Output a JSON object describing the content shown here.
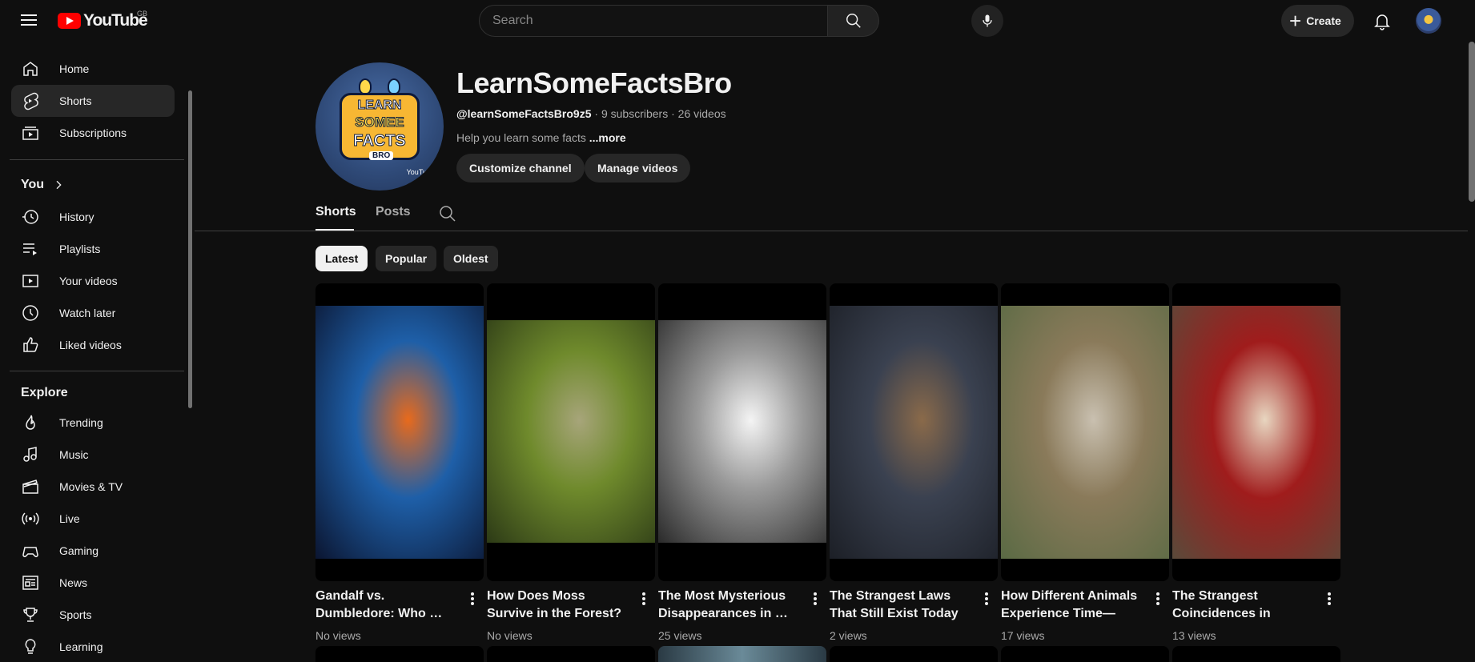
{
  "topbar": {
    "logo_text": "YouTube",
    "country_code": "GB",
    "search_placeholder": "Search",
    "create_label": "Create"
  },
  "sidebar": {
    "primary": [
      {
        "label": "Home",
        "icon": "home-icon"
      },
      {
        "label": "Shorts",
        "icon": "shorts-icon",
        "active": true
      },
      {
        "label": "Subscriptions",
        "icon": "subscriptions-icon"
      }
    ],
    "you_heading": "You",
    "you_items": [
      {
        "label": "History",
        "icon": "history-icon"
      },
      {
        "label": "Playlists",
        "icon": "playlists-icon"
      },
      {
        "label": "Your videos",
        "icon": "your-videos-icon"
      },
      {
        "label": "Watch later",
        "icon": "watch-later-icon"
      },
      {
        "label": "Liked videos",
        "icon": "liked-videos-icon"
      }
    ],
    "explore_heading": "Explore",
    "explore_items": [
      {
        "label": "Trending",
        "icon": "trending-icon"
      },
      {
        "label": "Music",
        "icon": "music-icon"
      },
      {
        "label": "Movies & TV",
        "icon": "movies-icon"
      },
      {
        "label": "Live",
        "icon": "live-icon"
      },
      {
        "label": "Gaming",
        "icon": "gaming-icon"
      },
      {
        "label": "News",
        "icon": "news-icon"
      },
      {
        "label": "Sports",
        "icon": "sports-icon"
      },
      {
        "label": "Learning",
        "icon": "learning-icon"
      }
    ]
  },
  "channel": {
    "name": "LearnSomeFactsBro",
    "handle": "@learnSomeFactsBro9z5",
    "subscribers": "9 subscribers",
    "videos": "26 videos",
    "separator": " · ",
    "description": "Help you learn some facts ",
    "more_label": "...more",
    "avatar_lines": [
      "LEARN",
      "SOMEE",
      "FACTS",
      "BRO"
    ],
    "avatar_badge": "YouTub",
    "customize_label": "Customize channel",
    "manage_label": "Manage videos"
  },
  "tabs": [
    {
      "label": "Shorts",
      "active": true
    },
    {
      "label": "Posts",
      "active": false
    }
  ],
  "chips": [
    {
      "label": "Latest",
      "active": true
    },
    {
      "label": "Popular",
      "active": false
    },
    {
      "label": "Oldest",
      "active": false
    }
  ],
  "shorts": [
    {
      "title": "Gandalf vs. Dumbledore: Who …",
      "views": "No views",
      "palette": [
        "#0b1530",
        "#1e5fa8",
        "#e86a1c"
      ]
    },
    {
      "title": "How Does Moss Survive in the Forest? Nature's …",
      "views": "No views",
      "palette": [
        "#2c3a16",
        "#6f8a2c",
        "#a7a57a"
      ]
    },
    {
      "title": "The Most Mysterious Disappearances in …",
      "views": "25 views",
      "palette": [
        "#2a2a2a",
        "#9a9a9a",
        "#f4f4f4"
      ]
    },
    {
      "title": "The Strangest Laws That Still Exist Today",
      "views": "2 views",
      "palette": [
        "#1c1f26",
        "#3a4150",
        "#8a6a4a"
      ]
    },
    {
      "title": "How Different Animals Experience Time—Why…",
      "views": "17 views",
      "palette": [
        "#5a6a44",
        "#8a7a5a",
        "#c9c0b0"
      ]
    },
    {
      "title": "The Strangest Coincidences in Histor…",
      "views": "13 views",
      "palette": [
        "#5a4a3a",
        "#a01c1c",
        "#e8d6c0"
      ]
    }
  ]
}
